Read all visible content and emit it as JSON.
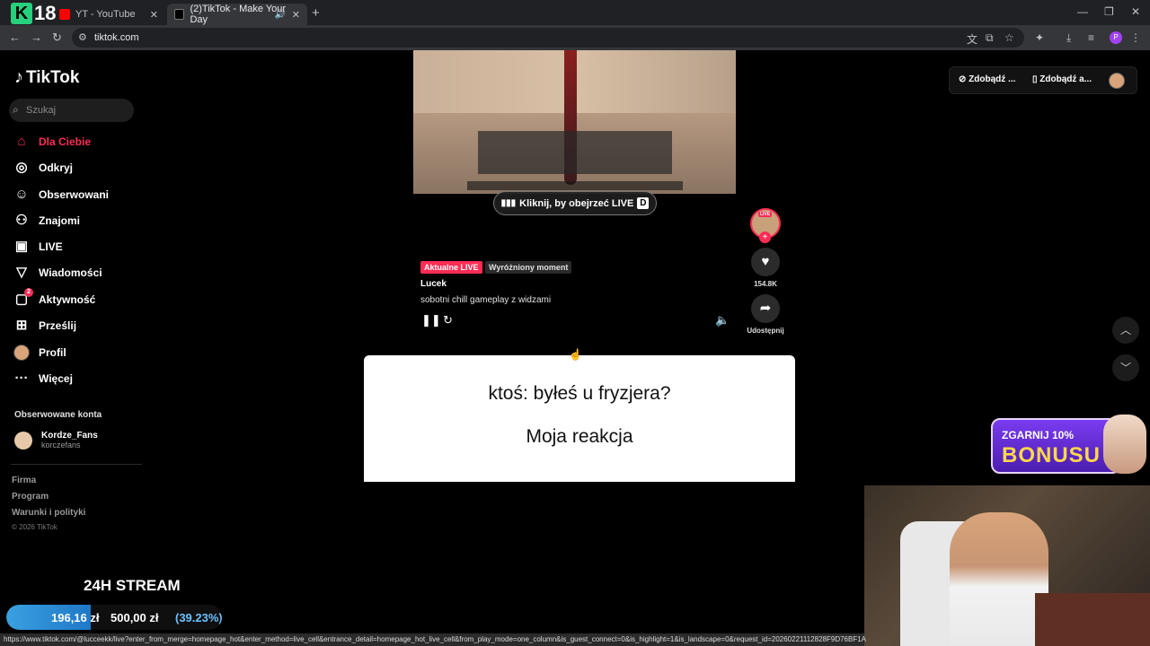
{
  "browser": {
    "tabs": [
      {
        "label": "YT - YouTube"
      },
      {
        "label": "(2)TikTok - Make Your Day"
      }
    ],
    "url": "tiktok.com",
    "status_url": "https://www.tiktok.com/@lucceekk/live?enter_from_merge=homepage_hot&enter_method=live_cell&entrance_detail=homepage_hot_live_cell&from_play_mode=one_column&is_guest_connect=0&is_highlight=1&is_landscape=0&request_id=20260221112828F9D76BF1A",
    "profile_letter": "P"
  },
  "overlay_logo": {
    "k": "K",
    "n": "18"
  },
  "sidebar": {
    "brand": "TikTok",
    "search_placeholder": "Szukaj",
    "items": [
      {
        "label": "Dla Ciebie",
        "icon": "home-icon"
      },
      {
        "label": "Odkryj",
        "icon": "compass-icon"
      },
      {
        "label": "Obserwowani",
        "icon": "following-icon"
      },
      {
        "label": "Znajomi",
        "icon": "friends-icon"
      },
      {
        "label": "LIVE",
        "icon": "live-icon"
      },
      {
        "label": "Wiadomości",
        "icon": "messages-icon"
      },
      {
        "label": "Aktywność",
        "icon": "activity-icon",
        "badge": "2"
      },
      {
        "label": "Prześlij",
        "icon": "upload-icon"
      },
      {
        "label": "Profil",
        "icon": "profile-avatar"
      },
      {
        "label": "Więcej",
        "icon": "more-icon"
      }
    ],
    "followed_title": "Obserwowane konta",
    "followed": [
      {
        "name": "Kordze_Fans",
        "handle": "korczefans"
      }
    ],
    "footer": [
      "Firma",
      "Program",
      "Warunki i polityki"
    ],
    "copyright": "© 2026 TikTok"
  },
  "video": {
    "live_button": "Kliknij, by obejrzeć LIVE",
    "live_key": "D",
    "tag_live": "Aktualne LIVE",
    "tag_moment": "Wyróżniony moment",
    "author": "Lucek",
    "description": "sobotni chill gameplay z widzami"
  },
  "actions": {
    "avatar_live": "LIVE",
    "likes": "154.8K",
    "share_label": "Udostępnij"
  },
  "top_right": {
    "pill1": "Zdobądź ...",
    "pill2": "Zdobądź a..."
  },
  "reaction_card": {
    "line1": "ktoś: byłeś u fryzjera?",
    "line2": "Moja reakcja"
  },
  "bonus_banner": {
    "line1": "ZGARNIJ 10%",
    "line2": "BONUSU"
  },
  "stream_overlay": {
    "title": "24H STREAM",
    "current": "196,16 zł",
    "goal": "500,00 zł",
    "percent_text": "(39.23%)",
    "progress": 0.3923
  },
  "colors": {
    "accent": "#fe2c55",
    "progress": "#3aa0e0"
  }
}
